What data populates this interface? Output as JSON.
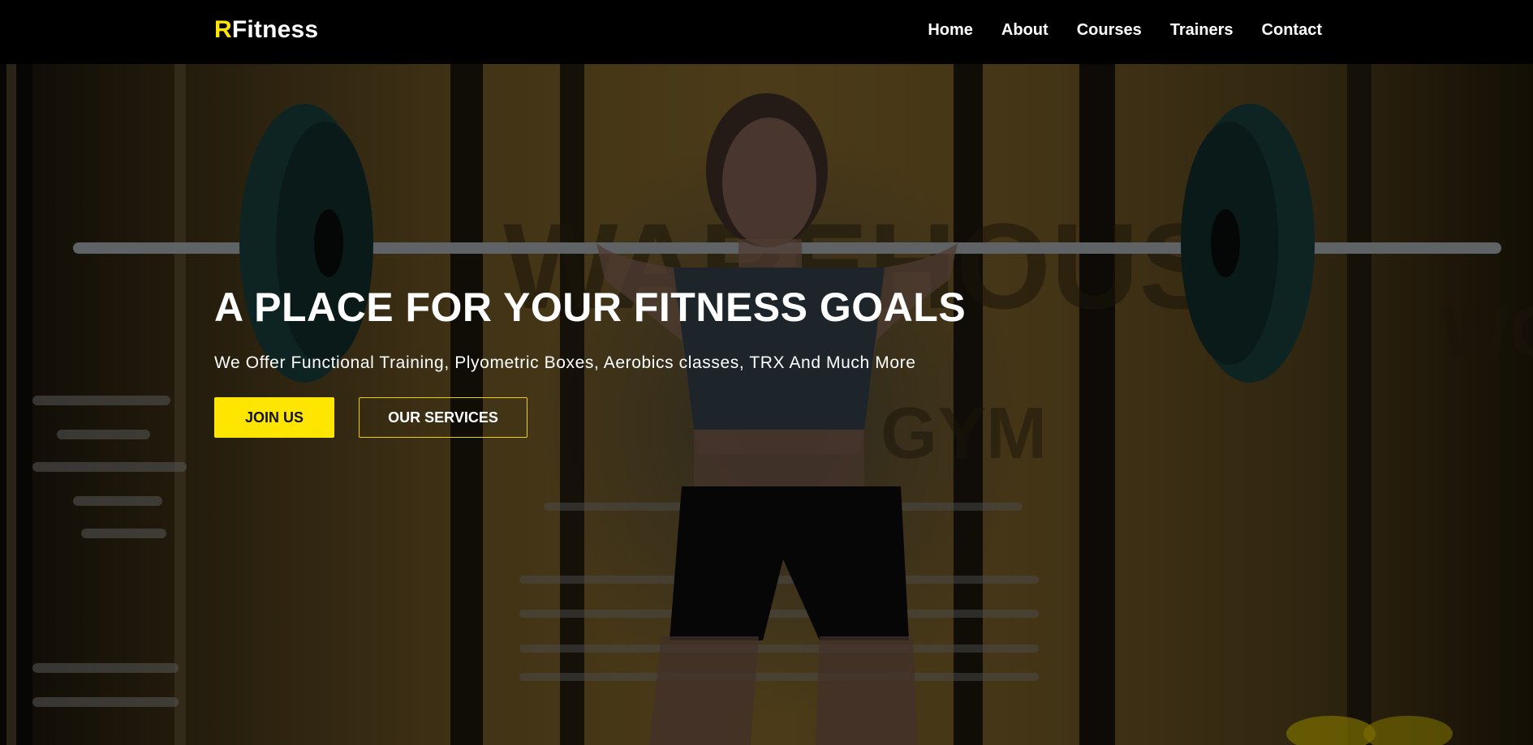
{
  "brand": {
    "logo_accent": "R",
    "logo_rest": "Fitness",
    "accent_color": "#ffe600"
  },
  "nav": {
    "items": [
      {
        "label": "Home"
      },
      {
        "label": "About"
      },
      {
        "label": "Courses"
      },
      {
        "label": "Trainers"
      },
      {
        "label": "Contact"
      }
    ]
  },
  "hero": {
    "title": "A PLACE FOR YOUR FITNESS GOALS",
    "subtitle": "We Offer Functional Training, Plyometric Boxes, Aerobics classes, TRX And Much More",
    "primary_button": "JOIN US",
    "secondary_button": "OUR SERVICES",
    "background_image": "gym-barbell-athlete-photo"
  }
}
